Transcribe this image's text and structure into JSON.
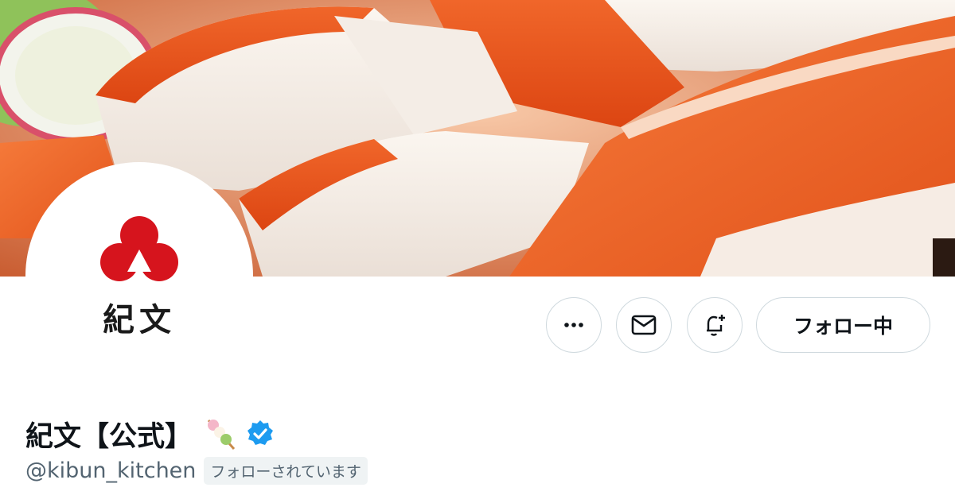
{
  "profile": {
    "display_name": "紀文【公式】",
    "handle": "@kibun_kitchen",
    "follows_you_label": "フォローされています",
    "verified": true
  },
  "avatar": {
    "logo_text": "紀文",
    "logo_color": "#d6141d"
  },
  "actions": {
    "more_icon": "more-icon",
    "message_icon": "envelope-icon",
    "notify_icon": "bell-plus-icon",
    "follow_label": "フォロー中"
  },
  "banner": {
    "description_icon": "kanikama-food-photo"
  },
  "colors": {
    "verified_blue": "#1d9bf0",
    "text_primary": "#0f1419",
    "text_secondary": "#536471",
    "border": "#cfd9de",
    "badge_bg": "#eff3f4"
  }
}
